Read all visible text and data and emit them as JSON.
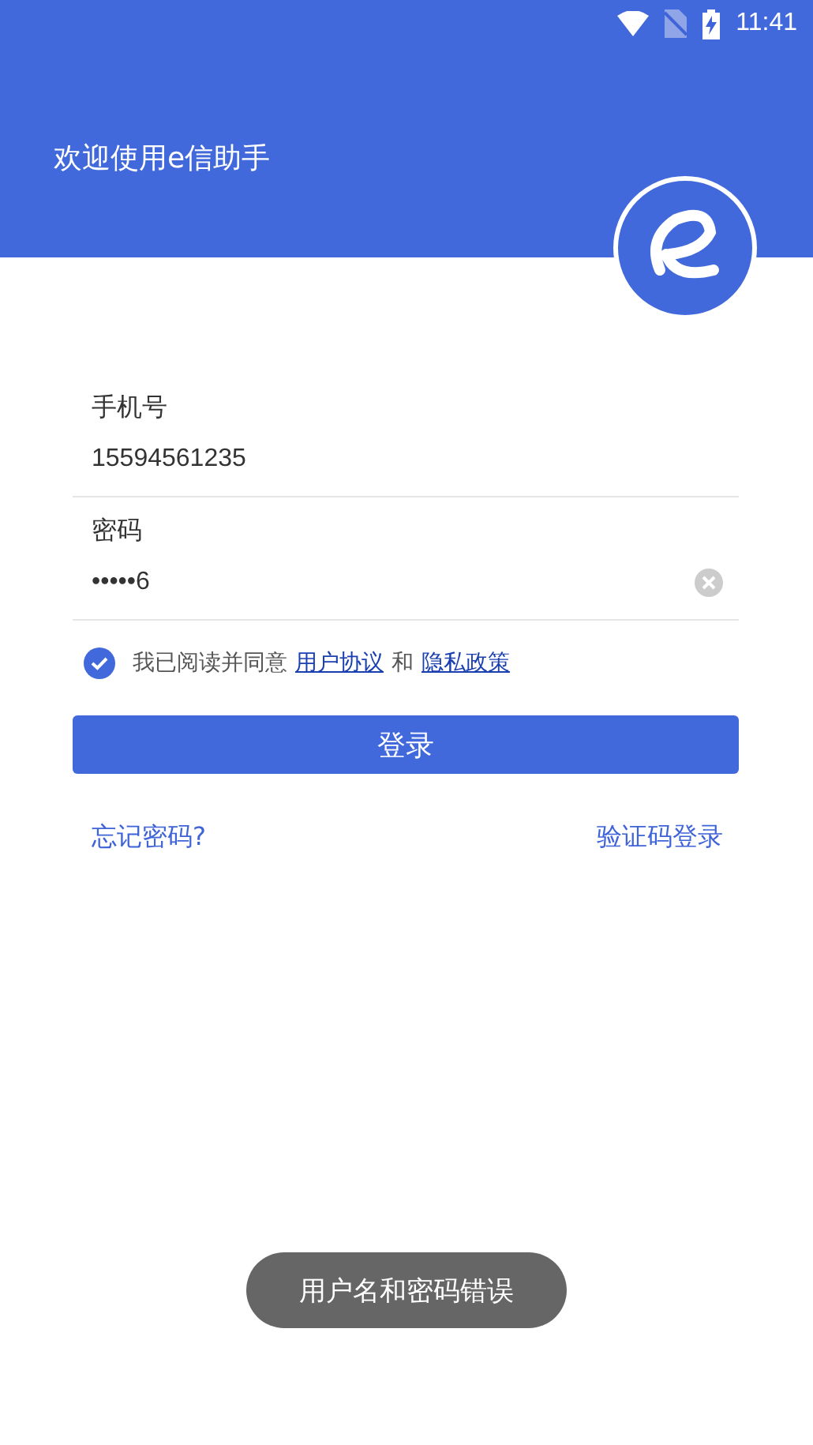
{
  "status_bar": {
    "time": "11:41"
  },
  "header": {
    "title": "欢迎使用e信助手"
  },
  "fields": [
    {
      "label": "手机号",
      "value": "15594561235",
      "clearable": false
    },
    {
      "label": "密码",
      "value": "•••••6",
      "clearable": true
    }
  ],
  "agreement": {
    "checked": true,
    "text": "我已阅读并同意",
    "links": [
      "用户协议",
      "隐私政策"
    ],
    "joiner": "和"
  },
  "login_button": "登录",
  "links": [
    "忘记密码?",
    "验证码登录"
  ],
  "toast": "用户名和密码错误"
}
